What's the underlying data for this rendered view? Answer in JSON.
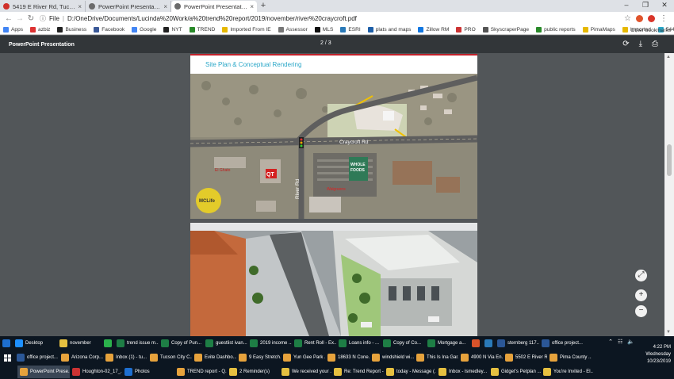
{
  "browser": {
    "tabs": [
      {
        "title": "5419 E River Rd, Tucson, AZ, 857...",
        "favicon_color": "#d0302a",
        "active": false
      },
      {
        "title": "PowerPoint Presentation",
        "favicon_color": "#6b6b6b",
        "active": false
      },
      {
        "title": "PowerPoint Presentation",
        "favicon_color": "#6b6b6b",
        "active": true
      }
    ],
    "url_prefix": "File",
    "url": "D:/OneDrive/Documents/Lucinda%20Work/a%20trend%20report/2019/november/river%20craycroft.pdf",
    "bookmarks": [
      {
        "label": "Apps",
        "color": "#4285f4"
      },
      {
        "label": "azbiz",
        "color": "#d33"
      },
      {
        "label": "Business",
        "color": "#222"
      },
      {
        "label": "Facebook",
        "color": "#3b5998"
      },
      {
        "label": "Google",
        "color": "#4285f4"
      },
      {
        "label": "NYT",
        "color": "#222"
      },
      {
        "label": "TREND",
        "color": "#2a8a2a"
      },
      {
        "label": "Imported From IE",
        "color": "#e6b800"
      },
      {
        "label": "Assessor",
        "color": "#777"
      },
      {
        "label": "MLS",
        "color": "#111"
      },
      {
        "label": "ESRI",
        "color": "#2a7ab8"
      },
      {
        "label": "plats and maps",
        "color": "#1e5fa8"
      },
      {
        "label": "Zillow RM",
        "color": "#1277e1"
      },
      {
        "label": "PRO",
        "color": "#c33"
      },
      {
        "label": "SkyscraperPage",
        "color": "#555"
      },
      {
        "label": "public reports",
        "color": "#2a8a2a"
      },
      {
        "label": "PimaMaps",
        "color": "#e6b800"
      },
      {
        "label": "Imported",
        "color": "#e6b800"
      },
      {
        "label": "544$",
        "color": "#2aa7c8"
      },
      {
        "label": "ACC",
        "color": "#e6b800"
      }
    ],
    "other_bookmarks": "Other bookmarks"
  },
  "pdf": {
    "title": "PowerPoint Presentation",
    "page_indicator": "2 / 3",
    "slide_heading": "Site Plan & Conceptual Rendering",
    "map_labels": {
      "craycroft": "Craycroft Rd",
      "river": "River Rd",
      "mclife": "MCLife",
      "qt": "QT",
      "whole_foods_1": "WHOLE",
      "whole_foods_2": "FOODS",
      "walgreens": "Walgreens",
      "elgato": "El Ghato"
    }
  },
  "taskbar": {
    "top_row": [
      {
        "label": "",
        "color": "#1e6fd0"
      },
      {
        "label": "Desktop",
        "color": "#1e90ff"
      },
      {
        "label": "november",
        "color": "#e6c040"
      },
      {
        "label": "",
        "color": "#2bb24c"
      },
      {
        "label": "trend issue m...",
        "color": "#1e7e45"
      },
      {
        "label": "Copy of Pun...",
        "color": "#1e7e45"
      },
      {
        "label": "guestlist ivan...",
        "color": "#1e7e45"
      },
      {
        "label": "2019 income ...",
        "color": "#1e7e45"
      },
      {
        "label": "Rent Roll - Ex...",
        "color": "#1e7e45"
      },
      {
        "label": "Loans info - ...",
        "color": "#1e7e45"
      },
      {
        "label": "Copy of Co...",
        "color": "#1e7e45"
      },
      {
        "label": "Mortgage a...",
        "color": "#1e7e45"
      },
      {
        "label": "",
        "color": "#d9532a"
      },
      {
        "label": "",
        "color": "#2a7ab8"
      },
      {
        "label": "sternberg 117...",
        "color": "#2b5797"
      },
      {
        "label": "office project...",
        "color": "#2b5797"
      }
    ],
    "middle_row": [
      {
        "label": "office project...",
        "color": "#2b5797"
      },
      {
        "label": "Arizona Corp...",
        "color": "#e6a23c"
      },
      {
        "label": "Inbox (1) - tu...",
        "color": "#e6a23c"
      },
      {
        "label": "Tucson City C...",
        "color": "#e6a23c"
      },
      {
        "label": "Evite Dashbo...",
        "color": "#e6a23c"
      },
      {
        "label": "9 Easy Stretch...",
        "color": "#e6a23c"
      },
      {
        "label": "Yun Gee Park ...",
        "color": "#e6a23c"
      },
      {
        "label": "18633 N Cone...",
        "color": "#e6a23c"
      },
      {
        "label": "windshield wi...",
        "color": "#e6a23c"
      },
      {
        "label": "This Is Ina Gar...",
        "color": "#e6a23c"
      },
      {
        "label": "4900 N Via En...",
        "color": "#e6a23c"
      },
      {
        "label": "5502 E River R...",
        "color": "#e6a23c"
      },
      {
        "label": "Pima County ...",
        "color": "#e6a23c"
      }
    ],
    "bottom_row": [
      {
        "label": "PowerPoint Prese...",
        "color": "#e6a23c",
        "active": true
      },
      {
        "label": "Houghton-02_17_...",
        "color": "#c33"
      },
      {
        "label": "Photos",
        "color": "#1e6fd0"
      },
      {
        "label": "TREND report - Q...",
        "color": "#e6a23c"
      },
      {
        "label": "2 Reminder(s)",
        "color": "#e6c040"
      },
      {
        "label": "We received your ...",
        "color": "#e6c040"
      },
      {
        "label": "Re: Trend Report -...",
        "color": "#e6c040"
      },
      {
        "label": "today - Message (...",
        "color": "#e6c040"
      },
      {
        "label": "Inbox - lsmedley...",
        "color": "#e6c040"
      },
      {
        "label": "Gidget's Petplan ...",
        "color": "#e6c040"
      },
      {
        "label": "You're Invited - El...",
        "color": "#e6c040"
      }
    ],
    "clock": {
      "time": "4:22 PM",
      "day": "Wednesday",
      "date": "10/23/2019"
    }
  }
}
